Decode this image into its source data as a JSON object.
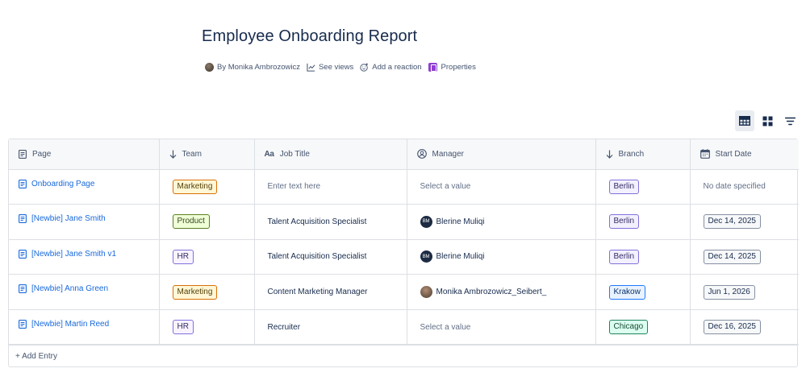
{
  "page": {
    "title": "Employee Onboarding Report"
  },
  "byline": {
    "author": "By Monika Ambrozowicz",
    "see_views": "See views",
    "add_reaction": "Add a reaction",
    "properties": "Properties"
  },
  "view_toggles": {
    "table_icon": "table-view-icon",
    "card_icon": "card-view-icon",
    "filter_icon": "filter-icon"
  },
  "table": {
    "columns": [
      {
        "label": "Page",
        "icon": "page-icon"
      },
      {
        "label": "Team",
        "icon": "arrow-down-icon"
      },
      {
        "label": "Job Title",
        "icon": "text-type-icon",
        "icon_text": "Aa"
      },
      {
        "label": "Manager",
        "icon": "user-icon"
      },
      {
        "label": "Branch",
        "icon": "arrow-down-icon"
      },
      {
        "label": "Start Date",
        "icon": "calendar-icon"
      }
    ],
    "rows": [
      {
        "page": "Onboarding Page",
        "team": "Marketing",
        "job": "Enter text here",
        "manager": "Select a value",
        "branch": "Berlin",
        "date": "No date specified"
      },
      {
        "page": "[Newbie] Jane Smith",
        "team": "Product",
        "job": "Talent Acquisition Specialist",
        "manager": "Blerine Muliqi",
        "manager_initials": "BM",
        "branch": "Berlin",
        "date": "Dec 14, 2025"
      },
      {
        "page": "[Newbie] Jane Smith v1",
        "team": "HR",
        "job": "Talent Acquisition Specialist",
        "manager": "Blerine Muliqi",
        "manager_initials": "BM",
        "branch": "Berlin",
        "date": "Dec 14, 2025"
      },
      {
        "page": "[Newbie] Anna Green",
        "team": "Marketing",
        "job": "Content Marketing Manager",
        "manager": "Monika Ambrozowicz_Seibert_",
        "branch": "Krakow",
        "date": "Jun 1, 2026"
      },
      {
        "page": "[Newbie] Martin Reed",
        "team": "HR",
        "job": "Recruiter",
        "manager": "Select a value",
        "branch": "Chicago",
        "date": "Dec 16, 2025"
      }
    ],
    "add_entry": "+ Add Entry"
  },
  "colors": {
    "link": "#1868db",
    "text": "#172b4d",
    "muted": "#626f86",
    "border": "#dcdfe4",
    "header_bg": "#f7f8f9"
  }
}
